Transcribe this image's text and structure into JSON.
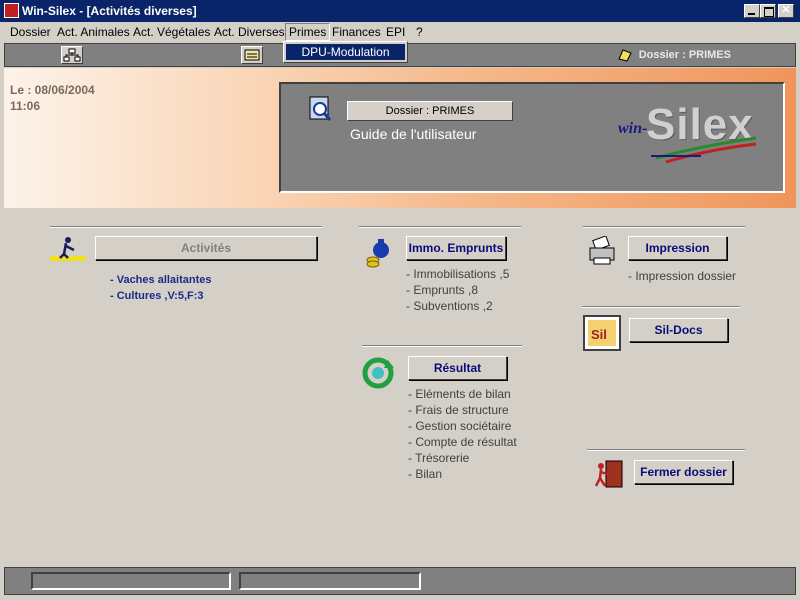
{
  "window": {
    "title": "Win-Silex - [Activités diverses]"
  },
  "menu": {
    "items": [
      "Dossier",
      "Act. Animales",
      "Act. Végétales",
      "Act. Diverses",
      "Primes",
      "Finances",
      "EPI",
      "?"
    ],
    "open_item": "Primes",
    "dropdown": [
      "DPU-Modulation"
    ]
  },
  "toolbar": {
    "folder_label": "Dossier : PRIMES"
  },
  "banner": {
    "date_line": "Le : 08/06/2004",
    "time_line": "11:06",
    "dossier_button": "Dossier : PRIMES",
    "guide_label": "Guide de l'utilisateur",
    "logo_main": "Silex",
    "logo_prefix": "win-"
  },
  "sections": {
    "activites": {
      "button": "Activités",
      "items": [
        "- Vaches allaitantes",
        "- Cultures ,V:5,F:3"
      ]
    },
    "immo": {
      "button": "Immo. Emprunts",
      "items": [
        "- Immobilisations ,5",
        "- Emprunts ,8",
        "- Subventions ,2"
      ]
    },
    "resultat": {
      "button": "Résultat",
      "items": [
        "- Eléments de bilan",
        "- Frais de structure",
        "- Gestion sociétaire",
        "- Compte de résultat",
        "- Trésorerie",
        "- Bilan"
      ]
    },
    "impression": {
      "button": "Impression",
      "items": [
        "- Impression dossier"
      ]
    },
    "sildocs": {
      "button": "Sil-Docs"
    },
    "fermer": {
      "button": "Fermer dossier"
    }
  },
  "colors": {
    "title_bar": "#0a246a",
    "banner_orange": "#f0955a",
    "link_blue": "#1a2a8a"
  }
}
